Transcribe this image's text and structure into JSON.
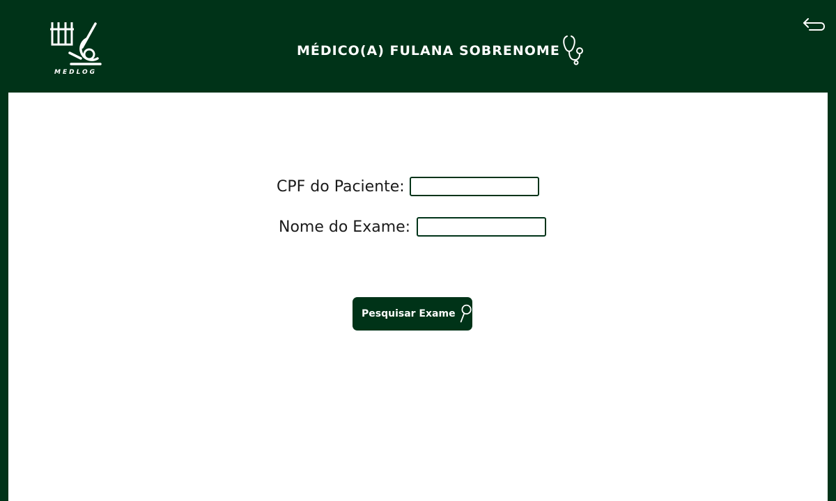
{
  "header": {
    "logo_text": "MEDLOG",
    "doctor_name": "MÉDICO(A) FULANA SOBRENOME",
    "doctor_icon": "stethoscope-icon",
    "back_icon": "back-arrow-icon"
  },
  "form": {
    "cpf_label": "CPF do Paciente:",
    "cpf_value": "",
    "exame_label": "Nome do Exame:",
    "exame_value": ""
  },
  "search_button": {
    "label": "Pesquisar Exame",
    "icon": "magnifier-icon"
  },
  "colors": {
    "primary_green": "#003318",
    "panel_background": "#ffffff",
    "text": "#1a1a1a"
  }
}
